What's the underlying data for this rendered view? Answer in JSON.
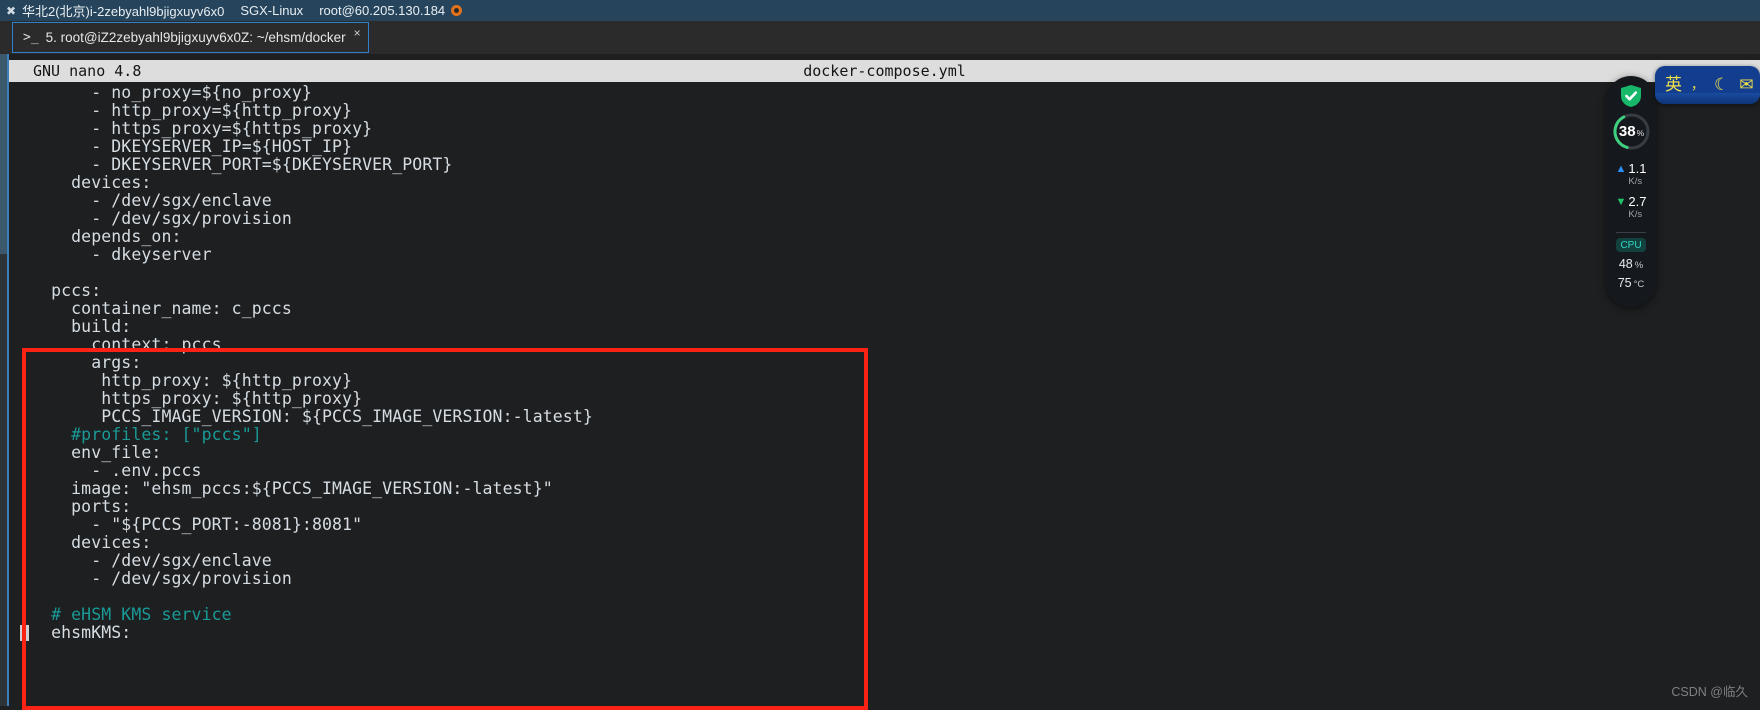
{
  "titlebar": {
    "icon": "terminal-cross-icon",
    "instance": "华北2(北京)i-2zebyahl9bjigxuyv6x0",
    "os": "SGX-Linux",
    "host": "root@60.205.130.184",
    "status_icon": "orange-dot-icon"
  },
  "tab": {
    "prompt_glyph": ">_",
    "label": "5. root@iZ2zebyahl9bjigxuyv6x0Z: ~/ehsm/docker",
    "close_glyph": "×"
  },
  "editor": {
    "app_version": "GNU nano 4.8",
    "filename": "docker-compose.yml",
    "lines": [
      {
        "text": "      - no_proxy=${no_proxy}",
        "comment": false
      },
      {
        "text": "      - http_proxy=${http_proxy}",
        "comment": false
      },
      {
        "text": "      - https_proxy=${https_proxy}",
        "comment": false
      },
      {
        "text": "      - DKEYSERVER_IP=${HOST_IP}",
        "comment": false
      },
      {
        "text": "      - DKEYSERVER_PORT=${DKEYSERVER_PORT}",
        "comment": false
      },
      {
        "text": "    devices:",
        "comment": false
      },
      {
        "text": "      - /dev/sgx/enclave",
        "comment": false
      },
      {
        "text": "      - /dev/sgx/provision",
        "comment": false
      },
      {
        "text": "    depends_on:",
        "comment": false
      },
      {
        "text": "      - dkeyserver",
        "comment": false
      },
      {
        "text": "",
        "comment": false
      },
      {
        "text": "  pccs:",
        "comment": false
      },
      {
        "text": "    container_name: c_pccs",
        "comment": false
      },
      {
        "text": "    build:",
        "comment": false
      },
      {
        "text": "      context: pccs",
        "comment": false
      },
      {
        "text": "      args:",
        "comment": false
      },
      {
        "text": "       http_proxy: ${http_proxy}",
        "comment": false
      },
      {
        "text": "       https_proxy: ${http_proxy}",
        "comment": false
      },
      {
        "text": "       PCCS_IMAGE_VERSION: ${PCCS_IMAGE_VERSION:-latest}",
        "comment": false
      },
      {
        "text": "    #profiles: [\"pccs\"]",
        "comment": true
      },
      {
        "text": "    env_file:",
        "comment": false
      },
      {
        "text": "      - .env.pccs",
        "comment": false
      },
      {
        "text": "    image: \"ehsm_pccs:${PCCS_IMAGE_VERSION:-latest}\"",
        "comment": false
      },
      {
        "text": "    ports:",
        "comment": false
      },
      {
        "text": "      - \"${PCCS_PORT:-8081}:8081\"",
        "comment": false
      },
      {
        "text": "    devices:",
        "comment": false
      },
      {
        "text": "      - /dev/sgx/enclave",
        "comment": false
      },
      {
        "text": "      - /dev/sgx/provision",
        "comment": false
      },
      {
        "text": "",
        "comment": false
      },
      {
        "text": "  # eHSM KMS service",
        "comment": true
      },
      {
        "text": "  ehsmKMS:",
        "comment": false,
        "cursor": true
      }
    ]
  },
  "annotation": {
    "color": "#fb2216",
    "shape": "rectangle"
  },
  "monitor": {
    "shield_icon": "shield-check-icon",
    "memory_percent": "38",
    "memory_unit": "%",
    "upload_icon": "arrow-up-icon",
    "upload_value": "1.1",
    "upload_unit": "K/s",
    "download_icon": "arrow-down-icon",
    "download_value": "2.7",
    "download_unit": "K/s",
    "cpu_label": "CPU",
    "cpu_percent": "48",
    "cpu_percent_unit": "%",
    "cpu_temp": "75",
    "cpu_temp_unit": "°C",
    "accent_green": "#1fc36a",
    "accent_blue": "#2d8ef5",
    "accent_teal": "#2fd6c6"
  },
  "ime": {
    "mode_glyph": "英",
    "punct_glyph": "，",
    "moon_glyph": "☾",
    "extra_glyph": "✉",
    "background": "#133e8f",
    "text_color": "#f2e04a"
  },
  "watermark": {
    "text": "CSDN @临久"
  }
}
